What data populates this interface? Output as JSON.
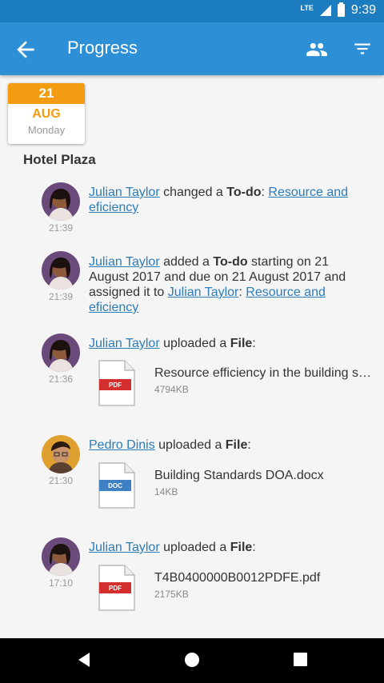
{
  "status": {
    "network": "LTE",
    "time": "9:39"
  },
  "appbar": {
    "title": "Progress"
  },
  "date": {
    "day": "21",
    "month": "AUG",
    "weekday": "Monday"
  },
  "project": "Hotel Plaza",
  "entries": [
    {
      "user": "Julian Taylor",
      "time": "21:39",
      "parts": [
        " changed a ",
        "To-do",
        ": "
      ],
      "link": "Resource and eficiency"
    },
    {
      "user": "Julian Taylor",
      "time": "21:39",
      "parts": [
        " added a ",
        "To-do",
        " starting on 21 August 2017 and due on 21 August 2017 and assigned it to ",
        ": "
      ],
      "user2": "Julian Taylor",
      "link": "Resource and eficiency"
    },
    {
      "user": "Julian Taylor",
      "time": "21:36",
      "parts": [
        " uploaded a ",
        "File",
        ":"
      ],
      "file": {
        "type": "PDF",
        "name": "Resource efficiency in the building sector.pdf",
        "size": "4794KB"
      }
    },
    {
      "user": "Pedro Dinis",
      "time": "21:30",
      "parts": [
        " uploaded a ",
        "File",
        ":"
      ],
      "file": {
        "type": "DOC",
        "name": "Building Standards DOA.docx",
        "size": "14KB"
      }
    },
    {
      "user": "Julian Taylor",
      "time": "17:10",
      "parts": [
        " uploaded a ",
        "File",
        ":"
      ],
      "file": {
        "type": "PDF",
        "name": "T4B0400000B0012PDFE.pdf",
        "size": "2175KB"
      }
    }
  ],
  "icons": {
    "back": "arrow-left-icon",
    "people": "people-icon",
    "filter": "filter-icon",
    "nav_back": "triangle-back-icon",
    "nav_home": "circle-home-icon",
    "nav_recent": "square-recent-icon"
  },
  "colors": {
    "status_bar": "#1c7cc0",
    "app_bar": "#2d8fd5",
    "date_accent": "#f39c12",
    "link": "#2d7cb8",
    "pdf": "#d32f2f",
    "doc": "#3f7fc4"
  }
}
